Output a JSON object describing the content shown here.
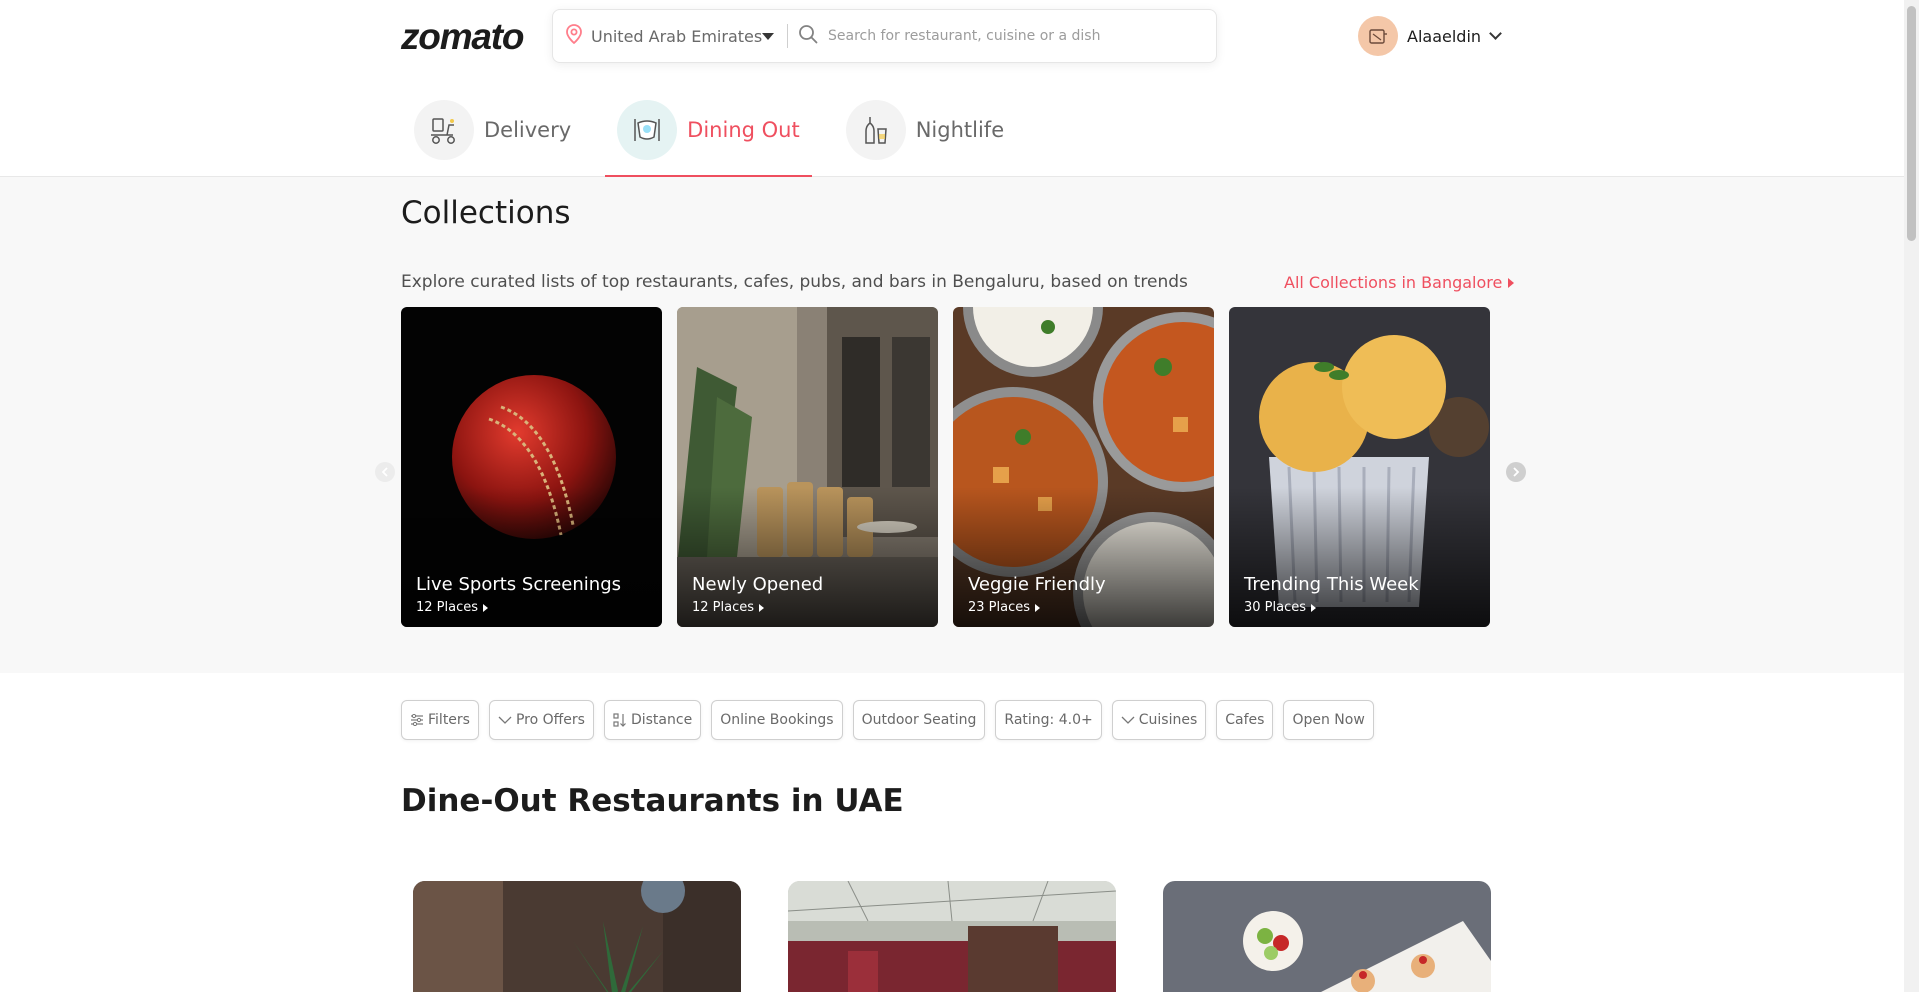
{
  "header": {
    "logo": "zomato",
    "location": "United Arab Emirates",
    "search_placeholder": "Search for restaurant, cuisine or a dish",
    "user_name": "Alaaeldin"
  },
  "tabs": [
    {
      "label": "Delivery",
      "icon": "delivery-icon",
      "active": false
    },
    {
      "label": "Dining Out",
      "icon": "dining-out-icon",
      "active": true
    },
    {
      "label": "Nightlife",
      "icon": "nightlife-icon",
      "active": false
    }
  ],
  "collections": {
    "title": "Collections",
    "subtitle": "Explore curated lists of top restaurants, cafes, pubs, and bars in Bengaluru, based on trends",
    "all_link": "All Collections in Bangalore",
    "cards": [
      {
        "title": "Live Sports Screenings",
        "count": "12 Places"
      },
      {
        "title": "Newly Opened",
        "count": "12 Places"
      },
      {
        "title": "Veggie Friendly",
        "count": "23 Places"
      },
      {
        "title": "Trending This Week",
        "count": "30 Places"
      }
    ]
  },
  "filters": [
    {
      "label": "Filters",
      "icon": "sliders-icon"
    },
    {
      "label": "Pro Offers",
      "icon": "chevron-down-icon"
    },
    {
      "label": "Distance",
      "icon": "distance-sort-icon"
    },
    {
      "label": "Online Bookings",
      "icon": ""
    },
    {
      "label": "Outdoor Seating",
      "icon": ""
    },
    {
      "label": "Rating: 4.0+",
      "icon": ""
    },
    {
      "label": "Cuisines",
      "icon": "chevron-down-icon"
    },
    {
      "label": "Cafes",
      "icon": ""
    },
    {
      "label": "Open Now",
      "icon": ""
    }
  ],
  "restaurants_heading": "Dine-Out Restaurants in UAE",
  "colors": {
    "accent": "#ef4f5f",
    "text": "#1c1c1c",
    "muted": "#696969",
    "section_bg": "#f8f8f8"
  }
}
